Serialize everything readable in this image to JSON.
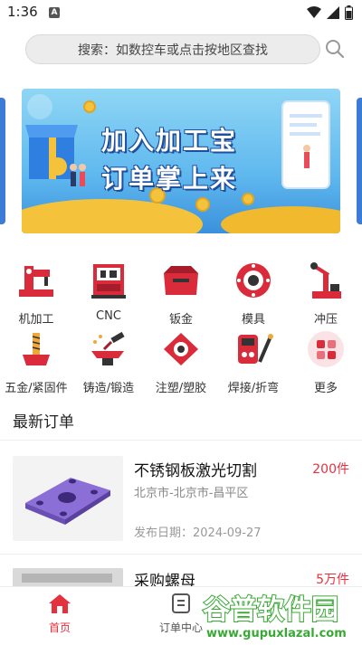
{
  "status_bar": {
    "time": "1:36",
    "notification_icon": "A"
  },
  "search": {
    "placeholder": "搜索：如数控车或点击按地区查找"
  },
  "banner": {
    "line1": "加入加工宝",
    "line2": "订单掌上来"
  },
  "categories": [
    {
      "label": "机加工",
      "icon": "machining-icon"
    },
    {
      "label": "CNC",
      "icon": "cnc-icon"
    },
    {
      "label": "钣金",
      "icon": "sheet-metal-icon"
    },
    {
      "label": "模具",
      "icon": "mold-icon"
    },
    {
      "label": "冲压",
      "icon": "stamping-icon"
    },
    {
      "label": "五金/紧固件",
      "icon": "fastener-icon"
    },
    {
      "label": "铸造/锻造",
      "icon": "forging-icon"
    },
    {
      "label": "注塑/塑胶",
      "icon": "injection-icon"
    },
    {
      "label": "焊接/折弯",
      "icon": "welding-icon"
    },
    {
      "label": "更多",
      "icon": "more-icon"
    }
  ],
  "latest_orders": {
    "title": "最新订单",
    "items": [
      {
        "name": "不锈钢板激光切割",
        "quantity": "200件",
        "location": "北京市-北京市-昌平区",
        "date": "发布日期：2024-09-27"
      },
      {
        "name": "采购螺母",
        "quantity": "5万件"
      }
    ]
  },
  "tabs": [
    {
      "label": "首页",
      "active": true
    },
    {
      "label": "订单中心",
      "active": false
    }
  ],
  "watermark": {
    "brand": "谷普软件园",
    "url": "www.gupuxlazal.com"
  },
  "colors": {
    "accent": "#e5303e",
    "icon_red": "#d92b3a",
    "watermark_green": "#39a935"
  }
}
